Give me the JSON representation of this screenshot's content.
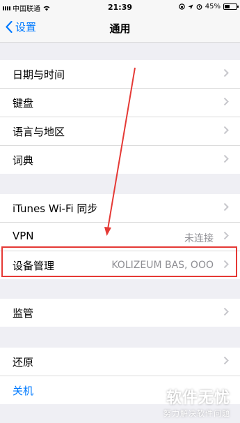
{
  "status": {
    "carrier": "中国联通",
    "time": "21:39",
    "battery": "45%",
    "battery_level": 0.45
  },
  "nav": {
    "back_label": "设置",
    "title": "通用"
  },
  "group1": [
    {
      "label": "日期与时间"
    },
    {
      "label": "键盘"
    },
    {
      "label": "语言与地区"
    },
    {
      "label": "词典"
    }
  ],
  "group2": [
    {
      "label": "iTunes Wi-Fi 同步",
      "value": ""
    },
    {
      "label": "VPN",
      "value": "未连接"
    },
    {
      "label": "设备管理",
      "value": "KOLIZEUM BAS, OOO"
    }
  ],
  "group3": [
    {
      "label": "监管"
    }
  ],
  "group4": [
    {
      "label": "还原"
    },
    {
      "label": "关机"
    }
  ],
  "watermark": {
    "title": "软件无忧",
    "subtitle": "努力解决软件问题"
  },
  "colors": {
    "accent": "#007aff",
    "annotation": "#e53935"
  }
}
